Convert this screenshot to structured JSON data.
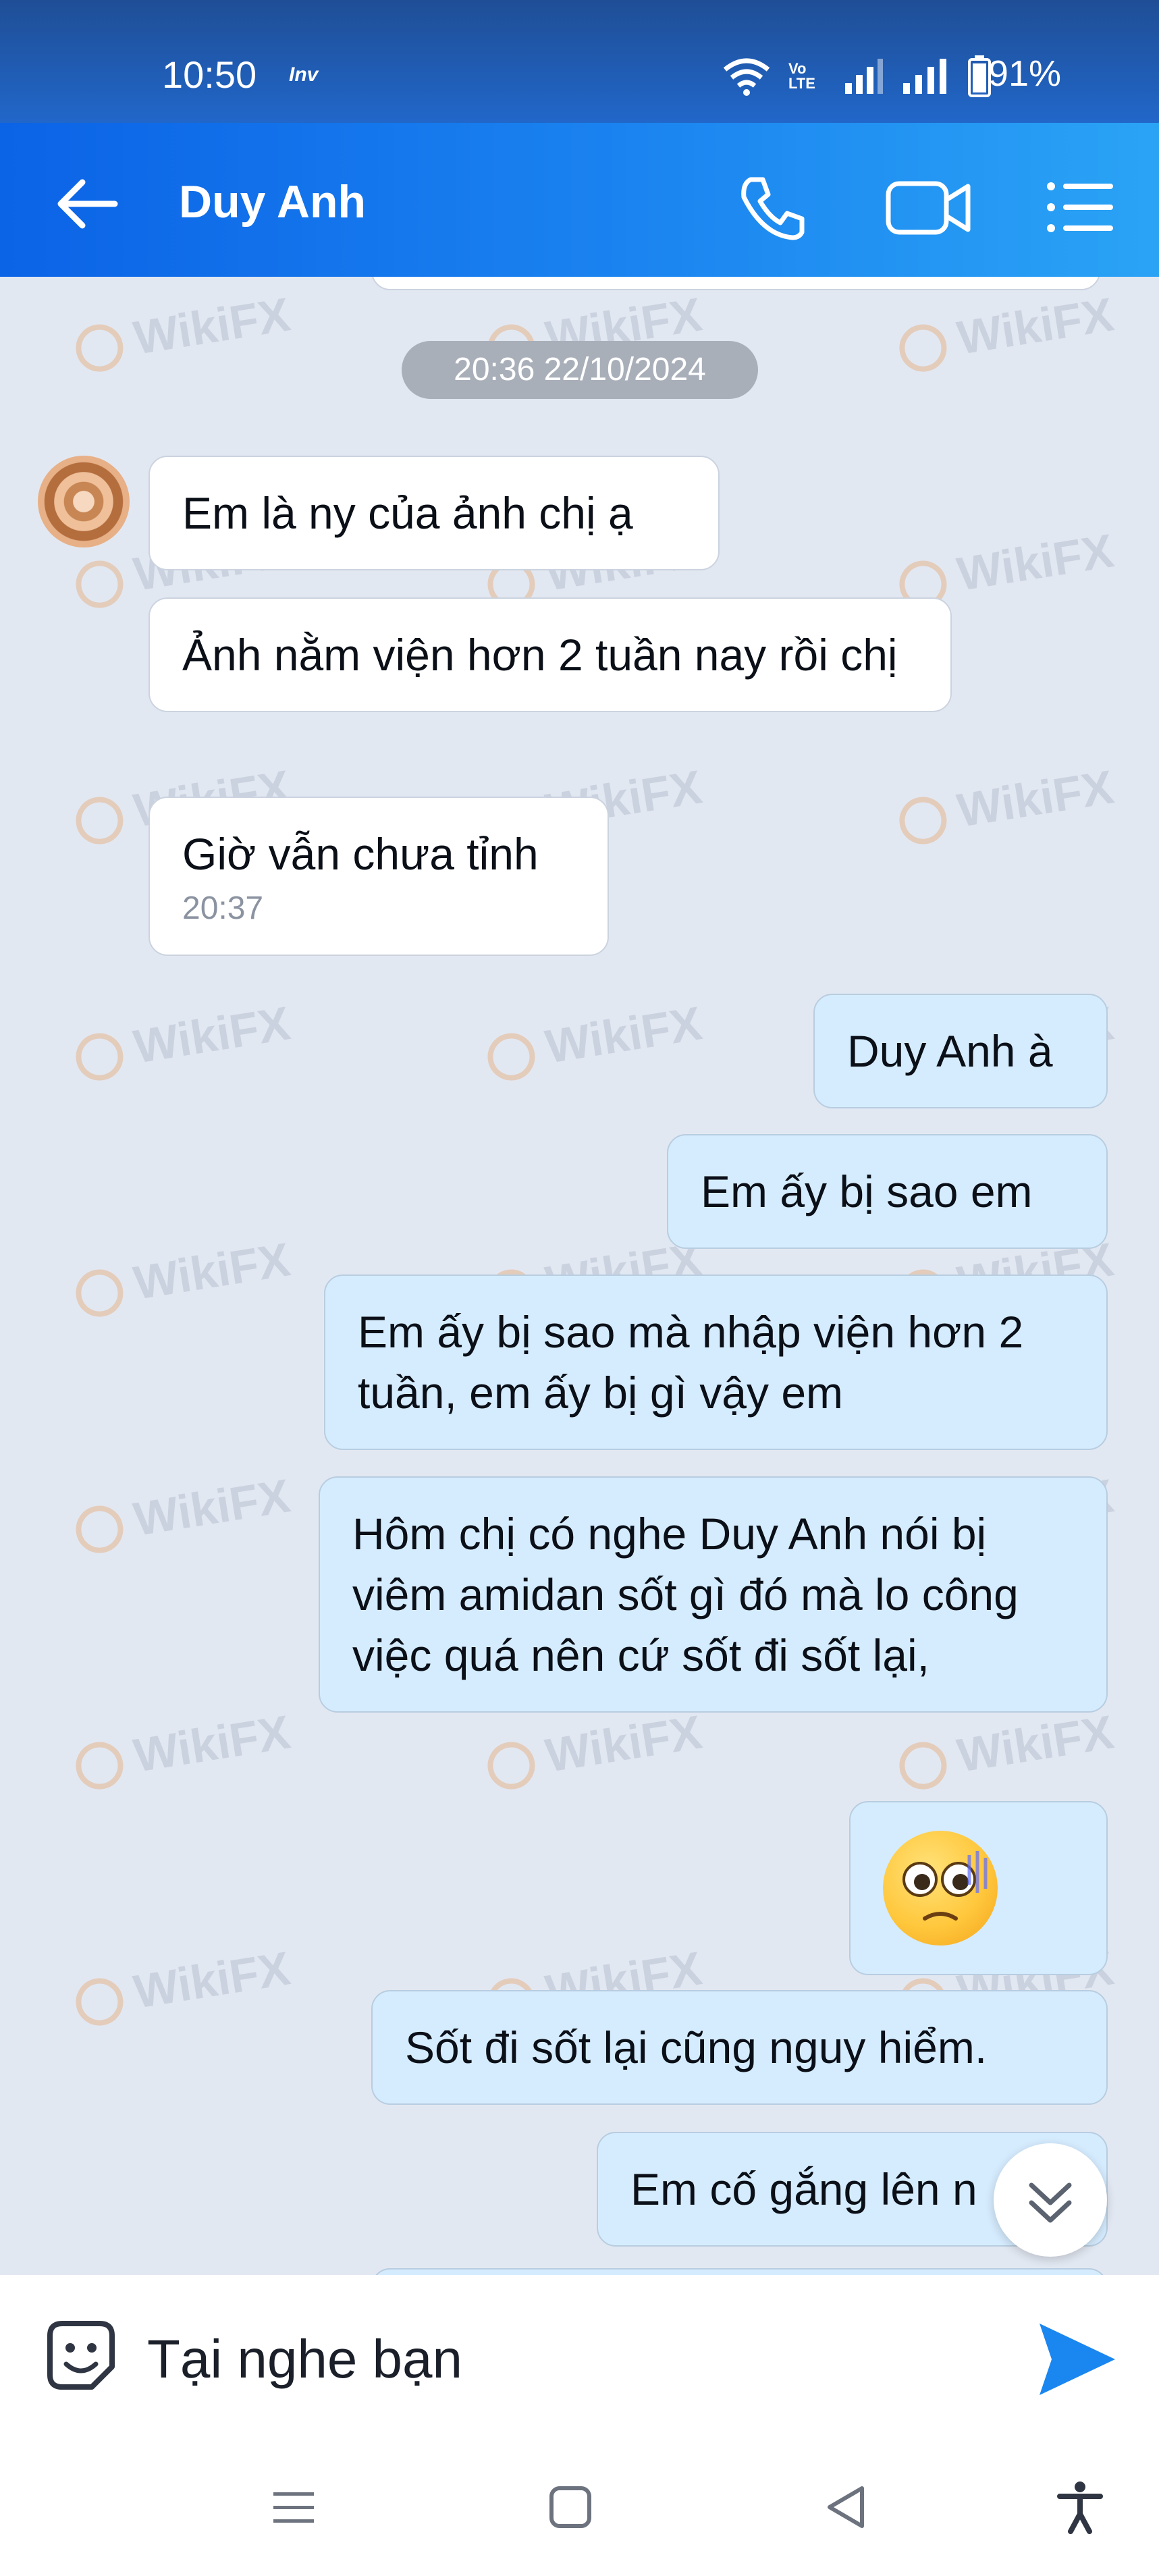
{
  "status": {
    "time": "10:50",
    "carrier": "Inv",
    "lte_label": "Vo LTE",
    "battery": "91%"
  },
  "header": {
    "title": "Duy Anh"
  },
  "chat": {
    "timestamp_chip": "20:36 22/10/2024",
    "watermark": "WikiFX",
    "messages": [
      {
        "dir": "in",
        "text": "Em là ny của ảnh chị ạ"
      },
      {
        "dir": "in",
        "text": "Ảnh nằm viện hơn 2 tuần nay rồi chị"
      },
      {
        "dir": "in",
        "text": "Giờ vẫn chưa tỉnh",
        "time": "20:37"
      },
      {
        "dir": "out",
        "text": "Duy Anh à"
      },
      {
        "dir": "out",
        "text": "Em ấy bị sao em"
      },
      {
        "dir": "out",
        "text": "Em ấy bị sao mà nhập viện hơn 2 tuần, em ấy bị gì vậy em"
      },
      {
        "dir": "out",
        "text": "Hôm chị có nghe Duy Anh nói bị viêm amidan sốt gì đó mà lo công việc quá nên cứ sốt đi sốt lại,"
      },
      {
        "dir": "out",
        "emoji": "pleading-face-emoji"
      },
      {
        "dir": "out",
        "text": "Sốt đi sốt lại cũng nguy hiểm."
      },
      {
        "dir": "out",
        "text": "Em cố gắng lên n"
      }
    ]
  },
  "composer": {
    "value": "Tại nghe bạn"
  },
  "colors": {
    "header_blue": "#1b84f0",
    "outgoing_bubble": "#d5ecfe",
    "incoming_bubble": "#ffffff",
    "chat_bg": "#e2e8f2",
    "send_blue": "#1a86f0"
  }
}
